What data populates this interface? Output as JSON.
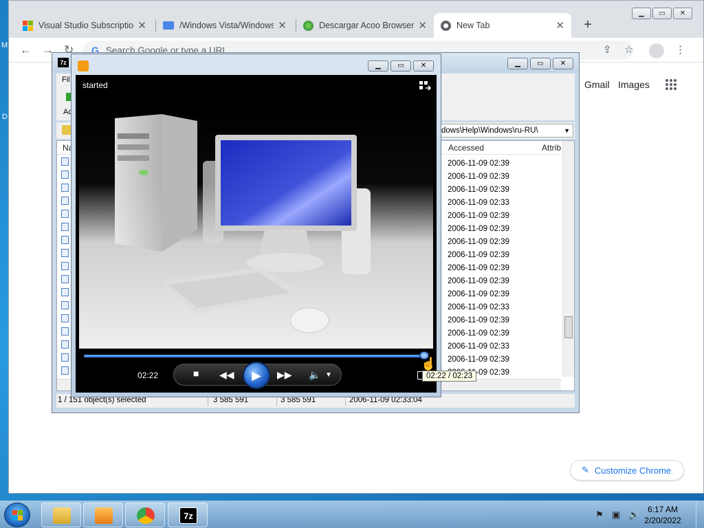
{
  "desktop": {
    "left_fragment_1": "M",
    "left_fragment_2": "D"
  },
  "chrome": {
    "tabs": [
      {
        "title": "Visual Studio Subscriptio",
        "icon": "microsoft-logo-icon"
      },
      {
        "title": "/Windows Vista/Windows",
        "icon": "folder-icon"
      },
      {
        "title": "Descargar Acoo Browser g",
        "icon": "acoo-browser-icon"
      },
      {
        "title": "New Tab",
        "icon": "chrome-icon"
      }
    ],
    "close_glyph": "✕",
    "new_tab_glyph": "+",
    "omnibox_placeholder": "Search Google or type a URL",
    "google_g": "G",
    "links": {
      "gmail": "Gmail",
      "images": "Images"
    },
    "customize_label": "Customize Chrome",
    "colors": {
      "tabstrip": "#dee1e6",
      "accent": "#1a73e8"
    }
  },
  "sevenzip": {
    "logo": "7z",
    "menu_fragment": "Fil",
    "toolbar_label_fragment": "Ac",
    "address_fragment": "dows\\Help\\Windows\\ru-RU\\",
    "columns": {
      "name_fragment": "Na",
      "accessed": "Accessed",
      "attributes_fragment": "Attrib"
    },
    "accessed_rows": [
      "2006-11-09 02:39",
      "2006-11-09 02:39",
      "2006-11-09 02:39",
      "2006-11-09 02:33",
      "2006-11-09 02:39",
      "2006-11-09 02:39",
      "2006-11-09 02:39",
      "2006-11-09 02:39",
      "2006-11-09 02:39",
      "2006-11-09 02:39",
      "2006-11-09 02:39",
      "2006-11-09 02:33",
      "2006-11-09 02:39",
      "2006-11-09 02:39",
      "2006-11-09 02:33",
      "2006-11-09 02:39",
      "2006-11-09 02:39"
    ],
    "status": {
      "selection": "1 / 151 object(s) selected",
      "size": "3 585 591",
      "packed": "3 585 591",
      "modified": "2006-11-09 02:33:04"
    }
  },
  "wmp": {
    "status_text": "started",
    "elapsed": "02:22",
    "tooltip": "02:22 / 02:23",
    "progress_fraction": 0.993
  },
  "taskbar": {
    "clock_time": "6:17 AM",
    "clock_date": "2/20/2022",
    "sevenzip_label": "7z"
  }
}
